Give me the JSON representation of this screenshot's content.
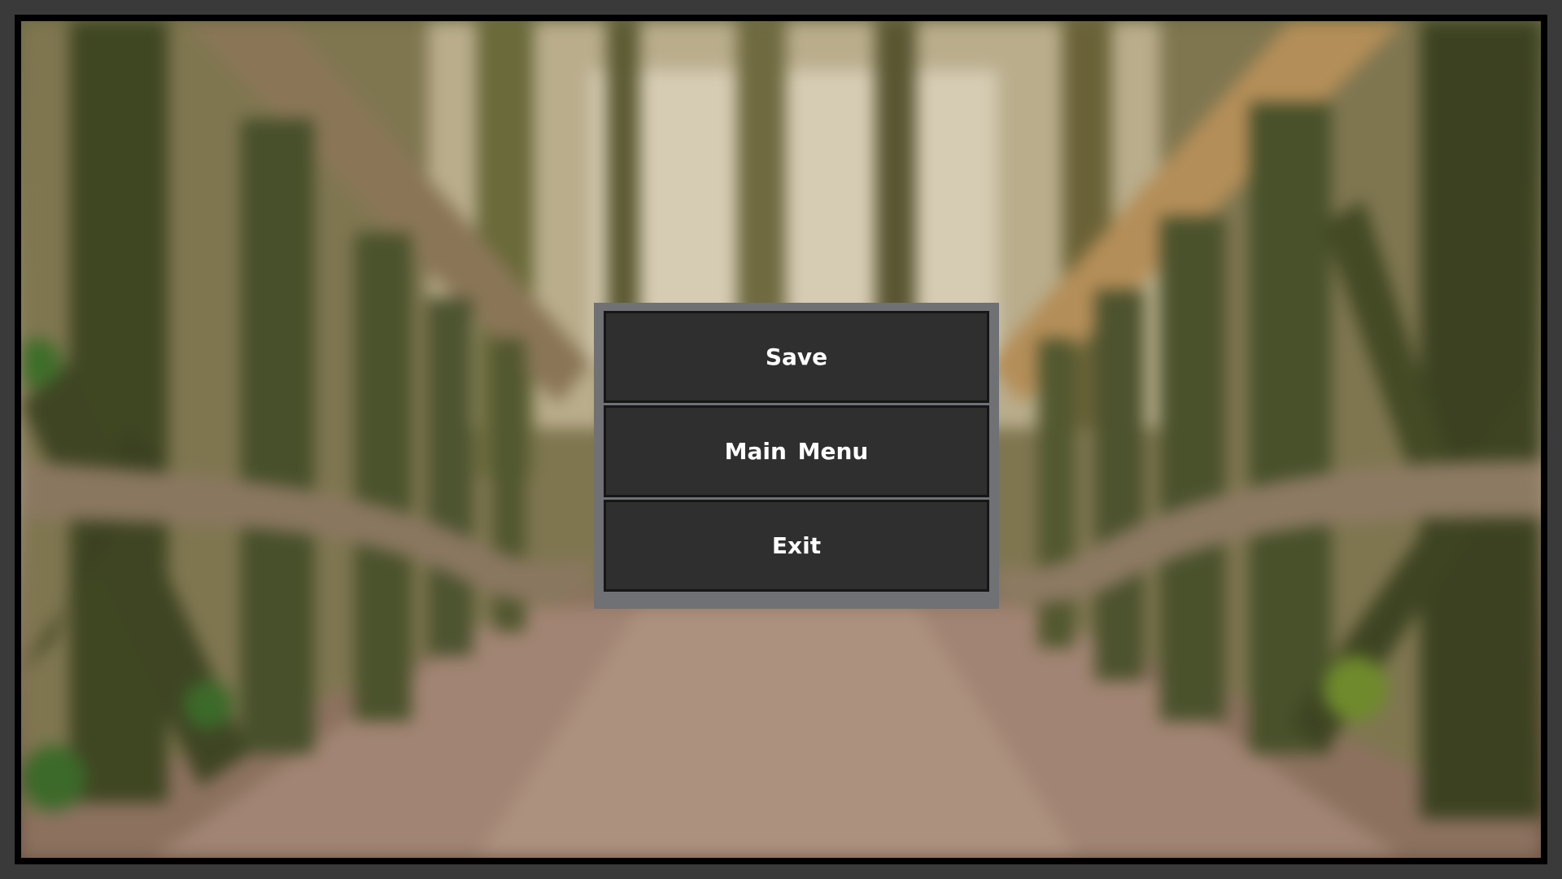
{
  "pause_menu": {
    "buttons": [
      {
        "label": "Save"
      },
      {
        "label": "Main Menu"
      },
      {
        "label": "Exit"
      }
    ]
  },
  "background": {
    "description_icon": "blurred-forest-bridge-image"
  }
}
